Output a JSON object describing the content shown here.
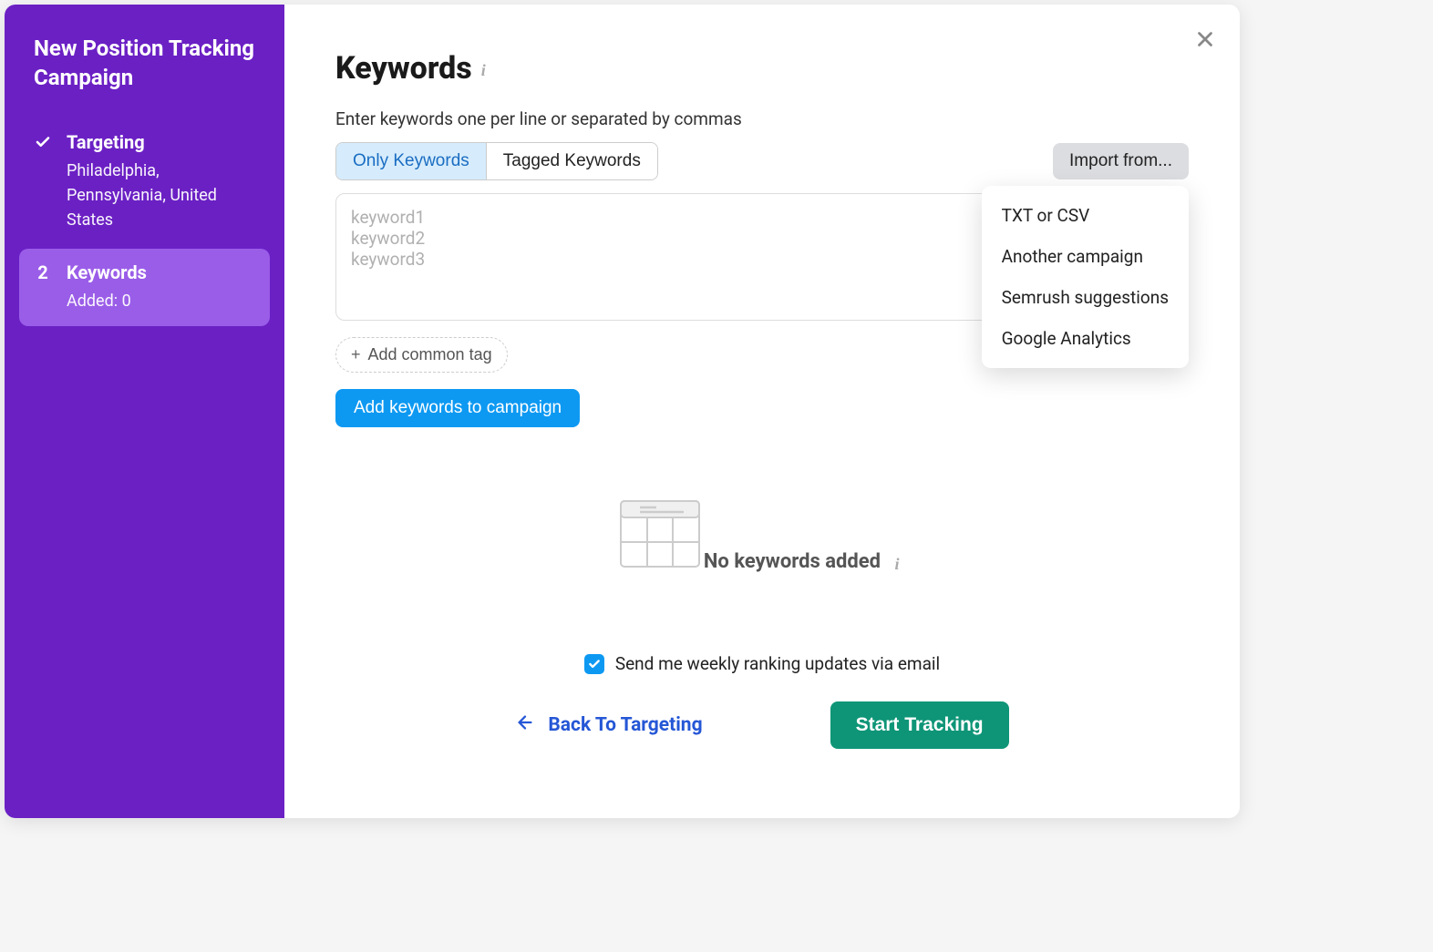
{
  "sidebar": {
    "title": "New Position Tracking Campaign",
    "steps": [
      {
        "label": "Targeting",
        "subtext": "Philadelphia, Pennsylvania, United States"
      },
      {
        "number": "2",
        "label": "Keywords",
        "subtext": "Added: 0"
      }
    ]
  },
  "main": {
    "title": "Keywords",
    "helper": "Enter keywords one per line or separated by commas",
    "tabs": {
      "only_keywords": "Only Keywords",
      "tagged_keywords": "Tagged Keywords"
    },
    "import_button": "Import from...",
    "import_options": [
      "TXT or CSV",
      "Another campaign",
      "Semrush suggestions",
      "Google Analytics"
    ],
    "textarea_placeholder": "keyword1\nkeyword2\nkeyword3",
    "add_tag_label": "Add common tag",
    "add_keywords_label": "Add keywords to campaign",
    "empty_state": "No keywords added",
    "checkbox_label": "Send me weekly ranking updates via email",
    "back_label": "Back To Targeting",
    "start_label": "Start Tracking"
  }
}
